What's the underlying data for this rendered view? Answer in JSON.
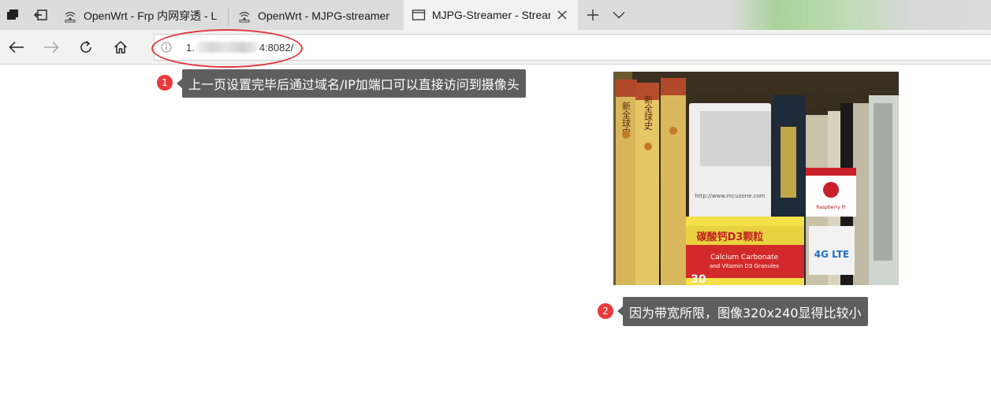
{
  "browser": {
    "tabs": [
      {
        "title": "OpenWrt - Frp 内网穿透 - L",
        "icon": "router-icon",
        "active": false
      },
      {
        "title": "OpenWrt - MJPG-streamer",
        "icon": "router-icon",
        "active": false
      },
      {
        "title": "MJPG-Streamer - Strear",
        "icon": "page-icon",
        "active": true
      }
    ],
    "address": {
      "url_prefix": "1.",
      "url_suffix": "4:8082/"
    }
  },
  "annotations": [
    {
      "number": "1",
      "text": "上一页设置完毕后通过域名/IP加端口可以直接访问到摄像头"
    },
    {
      "number": "2",
      "text": "因为带宽所限，图像320x240显得比较小"
    }
  ],
  "stream_image": {
    "book_labels": [
      "新全球史",
      "新全球史",
      "碳酸钙D3颗粒",
      "Calcium Carbonate",
      "and Vitamin D3 Granules",
      "Raspberry Pi",
      "4G LTE",
      "http://www.mcuzone.com",
      "30"
    ]
  },
  "colors": {
    "annotation_badge": "#e73a3a",
    "callout_bg": "#5e5e5e",
    "highlight": "#e0353a",
    "tabbar_bg": "#dcdcdc",
    "toolbar_bg": "#f2f2f2"
  }
}
